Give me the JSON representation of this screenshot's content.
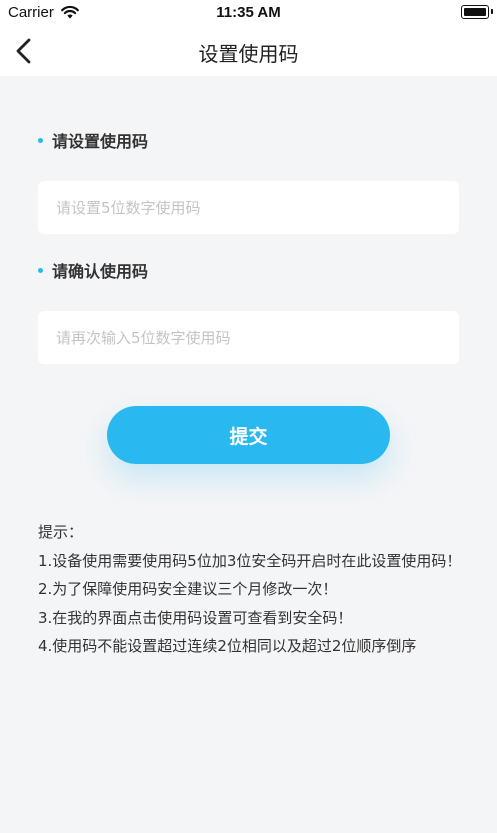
{
  "status_bar": {
    "carrier": "Carrier",
    "time": "11:35 AM"
  },
  "nav": {
    "title": "设置使用码",
    "back_icon": "chevron-left-icon"
  },
  "form": {
    "accent_color": "#2ab8f0",
    "set_label": "请设置使用码",
    "set_placeholder": "请设置5位数字使用码",
    "confirm_label": "请确认使用码",
    "confirm_placeholder": "请再次输入5位数字使用码",
    "submit_label": "提交"
  },
  "tips": {
    "heading": "提示：",
    "items": [
      "1.设备使用需要使用码5位加3位安全码开启时在此设置使用码！",
      "2.为了保障使用码安全建议三个月修改一次！",
      "3.在我的界面点击使用码设置可查看到安全码！",
      "4.使用码不能设置超过连续2位相同以及超过2位顺序倒序"
    ]
  }
}
